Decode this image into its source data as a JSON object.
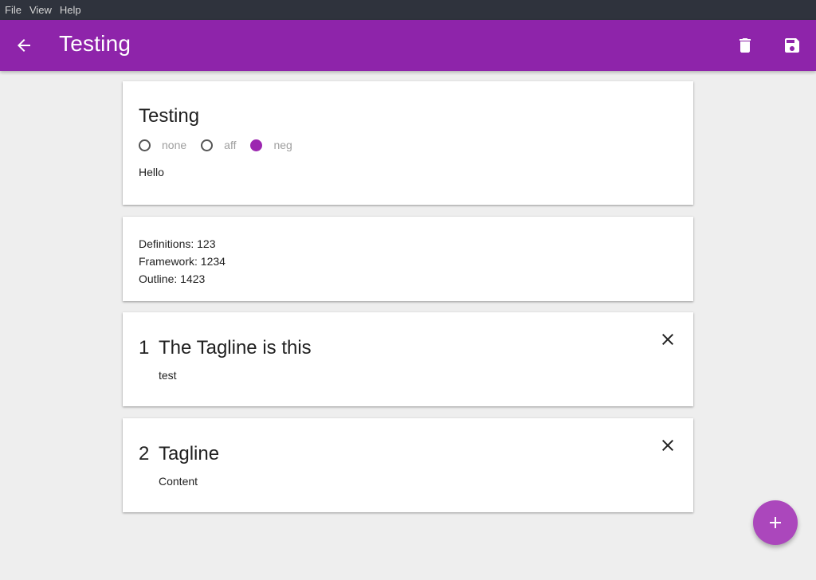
{
  "menubar": {
    "items": [
      "File",
      "View",
      "Help"
    ]
  },
  "appbar": {
    "title": "Testing",
    "back_icon": "arrow-back-icon",
    "delete_icon": "delete-icon",
    "save_icon": "save-icon"
  },
  "case_card": {
    "title": "Testing",
    "side_options": [
      {
        "label": "none",
        "selected": false
      },
      {
        "label": "aff",
        "selected": false
      },
      {
        "label": "neg",
        "selected": true
      }
    ],
    "body": "Hello"
  },
  "stats_card": {
    "lines": [
      "Definitions: 123",
      "Framework: 1234",
      "Outline: 1423"
    ]
  },
  "taglines": [
    {
      "number": "1",
      "title": "The Tagline is this",
      "body": "test"
    },
    {
      "number": "2",
      "title": "Tagline",
      "body": "Content"
    }
  ],
  "colors": {
    "accent": "#8e24aa",
    "fab": "#ab47bc",
    "menubar": "#2f333d"
  }
}
